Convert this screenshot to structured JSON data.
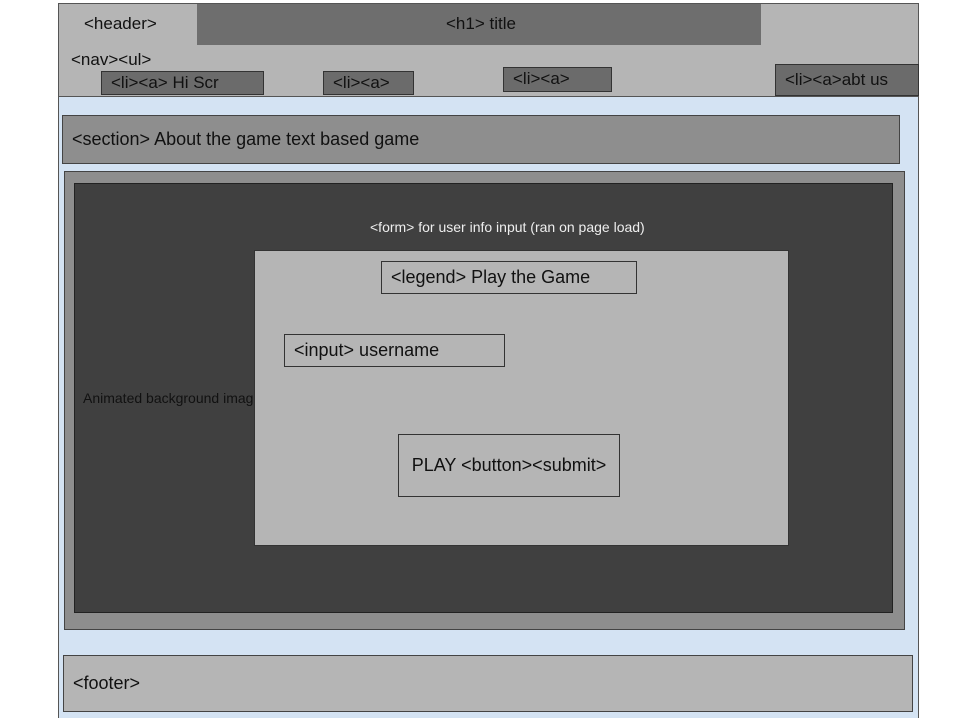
{
  "header": {
    "label": "<header>",
    "title": "<h1> title"
  },
  "nav": {
    "label": "<nav><ul>",
    "items": [
      {
        "label": "<li><a> Hi Scr"
      },
      {
        "label": "<li><a>"
      },
      {
        "label": "<li><a>"
      },
      {
        "label": "<li><a>abt us"
      }
    ]
  },
  "section": {
    "label": "<section> About the game text based game"
  },
  "main": {
    "background_label": "Animated background image",
    "form_label": "<form> for user info input (ran on page load)",
    "legend": "<legend> Play the Game",
    "input_label": "<input> username",
    "button_label": "PLAY <button><submit>"
  },
  "footer": {
    "label": "<footer>"
  },
  "colors": {
    "page_background": "#d4e3f3",
    "light_gray": "#b5b5b5",
    "mid_gray": "#8e8e8e",
    "dark_gray": "#404040",
    "nav_gray": "#6b6b6b"
  }
}
